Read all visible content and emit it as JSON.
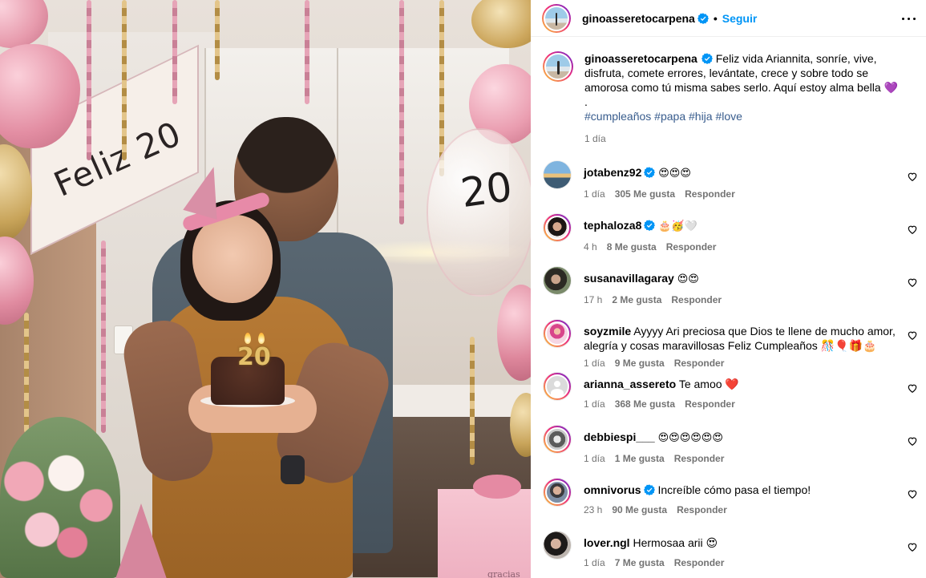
{
  "post": {
    "author": "ginoasseretocarpena",
    "follow_label": "Seguir",
    "header_separator": "•",
    "photo": {
      "banner_text": "Feliz 20",
      "balloon_text": "20",
      "candle_text": "20",
      "gift_text": "gracias"
    },
    "caption": {
      "text": "Feliz vida Ariannita, sonríe, vive, disfruta, comete errores, levántate, crece y sobre todo se amorosa como tú misma sabes serlo. Aquí estoy alma bella 💜",
      "dot_line": ".",
      "hashtags": [
        "#cumpleaños",
        "#papa",
        "#hija",
        "#love"
      ],
      "time": "1 día"
    }
  },
  "comments": [
    {
      "user": "jotabenz92",
      "verified": true,
      "text": "😍😍😍",
      "time": "1 día",
      "likes": "305 Me gusta",
      "reply": "Responder",
      "avatar_class": "av-jota"
    },
    {
      "user": "tephaloza8",
      "verified": true,
      "text": "🎂🥳🤍",
      "time": "4 h",
      "likes": "8 Me gusta",
      "reply": "Responder",
      "avatar_class": "av-teph"
    },
    {
      "user": "susanavillagaray",
      "verified": false,
      "text": "😍😍",
      "time": "17 h",
      "likes": "2 Me gusta",
      "reply": "Responder",
      "avatar_class": "av-susa"
    },
    {
      "user": "soyzmile",
      "verified": false,
      "text": "Ayyyy Ari preciosa que Dios te llene de mucho amor, alegría y cosas maravillosas Feliz Cumpleaños 🎊🎈🎁🎂",
      "time": "1 día",
      "likes": "9 Me gusta",
      "reply": "Responder",
      "avatar_class": "av-soyz"
    },
    {
      "user": "arianna_assereto",
      "verified": false,
      "text": "Te amoo ❤️",
      "time": "1 día",
      "likes": "368 Me gusta",
      "reply": "Responder",
      "avatar_class": "av-aria"
    },
    {
      "user": "debbiespi___",
      "verified": false,
      "text": "😍😍😍😍😍😍",
      "time": "1 día",
      "likes": "1 Me gusta",
      "reply": "Responder",
      "avatar_class": "av-debb"
    },
    {
      "user": "omnivorus",
      "verified": true,
      "text": "Increíble cómo pasa el tiempo!",
      "time": "23 h",
      "likes": "90 Me gusta",
      "reply": "Responder",
      "avatar_class": "av-omni"
    },
    {
      "user": "lover.ngl",
      "verified": false,
      "text": "Hermosaa arii 😍",
      "time": "1 día",
      "likes": "7 Me gusta",
      "reply": "Responder",
      "avatar_class": "av-love"
    }
  ],
  "icons": {
    "verified": "verified-badge-icon",
    "more": "more-options-icon",
    "like": "heart-outline-icon"
  },
  "colors": {
    "link_blue": "#0095f6",
    "hashtag": "#385c8d",
    "meta_gray": "#737373",
    "verified_blue": "#0095f6"
  }
}
